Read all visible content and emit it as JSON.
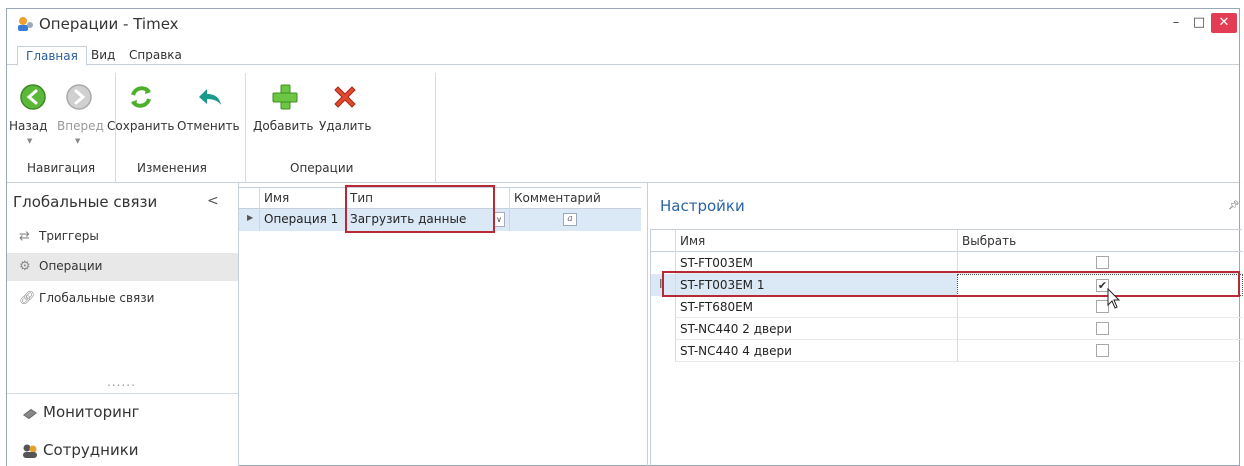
{
  "window": {
    "title": "Операции - Timex",
    "controls": {
      "minimize": "–",
      "maximize": "□",
      "close": "✕"
    }
  },
  "ribbon_tabs": [
    {
      "label": "Главная",
      "active": true
    },
    {
      "label": "Вид",
      "active": false
    },
    {
      "label": "Справка",
      "active": false
    }
  ],
  "ribbon": {
    "back": "Назад",
    "forward": "Вперед",
    "save": "Сохранить",
    "cancel": "Отменить",
    "add": "Добавить",
    "delete": "Удалить",
    "groups": {
      "navigation": "Навигация",
      "changes": "Изменения",
      "operations": "Операции"
    }
  },
  "nav": {
    "title": "Глобальные связи",
    "collapse": "<",
    "items": [
      {
        "label": "Триггеры",
        "icon": "arrows-icon",
        "selected": false
      },
      {
        "label": "Операции",
        "icon": "gear-icon",
        "selected": true
      },
      {
        "label": "Глобальные связи",
        "icon": "link-icon",
        "selected": false
      }
    ],
    "dots": "......",
    "big_items": [
      {
        "label": "Мониторинг",
        "icon": "monitor-icon"
      },
      {
        "label": "Сотрудники",
        "icon": "employees-icon"
      }
    ]
  },
  "operations_grid": {
    "columns": [
      "Имя",
      "Тип",
      "Комментарий"
    ],
    "rows": [
      {
        "name": "Операция 1",
        "type": "Загрузить данные",
        "comment": "a"
      }
    ]
  },
  "settings": {
    "title": "Настройки",
    "columns": [
      "Имя",
      "Выбрать"
    ],
    "rows": [
      {
        "name": "ST-FT003EM",
        "checked": false,
        "selected": false
      },
      {
        "name": "ST-FT003EM 1",
        "checked": true,
        "selected": true
      },
      {
        "name": "ST-FT680EM",
        "checked": false,
        "selected": false
      },
      {
        "name": "ST-NC440 2 двери",
        "checked": false,
        "selected": false
      },
      {
        "name": "ST-NC440 4 двери",
        "checked": false,
        "selected": false
      }
    ]
  },
  "colors": {
    "accent": "#2a64a8",
    "highlight_border": "#b72a35",
    "selected_row": "#dbe8f6",
    "close_button": "#e23d55"
  }
}
